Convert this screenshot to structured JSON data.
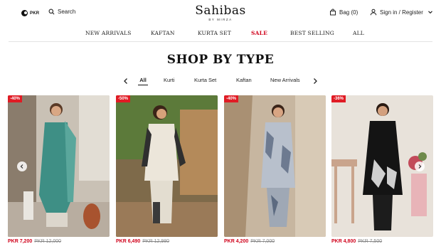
{
  "header": {
    "currency": "PKR",
    "search_label": "Search",
    "logo_name": "Sahibas",
    "logo_sub": "BY MIRZA",
    "bag_label": "Bag (0)",
    "account_label": "Sign in / Register"
  },
  "nav": {
    "items": [
      "NEW ARRIVALS",
      "KAFTAN",
      "KURTA SET",
      "SALE",
      "BEST SELLING",
      "ALL"
    ]
  },
  "section": {
    "title": "SHOP BY TYPE",
    "tabs": [
      "All",
      "Kurti",
      "Kurta Set",
      "Kaftan",
      "New Arrivals"
    ],
    "active_tab": "All"
  },
  "products": [
    {
      "badge": "-40%",
      "price": "PKR 7,200",
      "was": "PKR 12,000"
    },
    {
      "badge": "-50%",
      "price": "PKR 6,490",
      "was": "PKR 12,980"
    },
    {
      "badge": "-40%",
      "price": "PKR 4,200",
      "was": "PKR 7,000"
    },
    {
      "badge": "-36%",
      "price": "PKR 4,800",
      "was": "PKR 7,500"
    }
  ],
  "colors": {
    "accent_sale": "#d0021b",
    "badge": "#e01b24"
  },
  "icons": [
    "flag-icon",
    "search-icon",
    "bag-icon",
    "user-icon",
    "chevron-down-icon",
    "chevron-left-icon",
    "chevron-right-icon"
  ]
}
